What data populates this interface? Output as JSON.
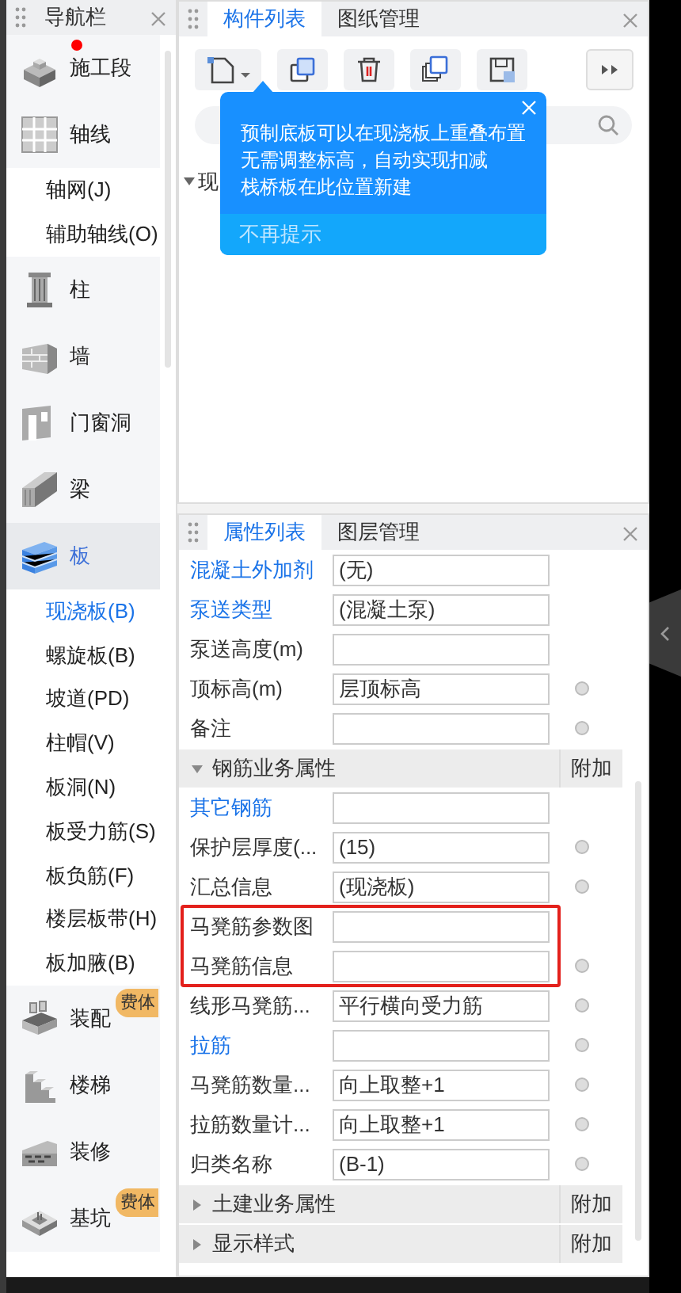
{
  "nav": {
    "title": "导航栏",
    "items": [
      {
        "label": "施工段",
        "selected": false,
        "notice": true
      },
      {
        "label": "轴线",
        "selected": false,
        "children": [
          {
            "label": "轴网(J)",
            "selected": false
          },
          {
            "label": "辅助轴线(O)",
            "selected": false
          }
        ]
      },
      {
        "label": "柱",
        "selected": false
      },
      {
        "label": "墙",
        "selected": false
      },
      {
        "label": "门窗洞",
        "selected": false
      },
      {
        "label": "梁",
        "selected": false
      },
      {
        "label": "板",
        "selected": true,
        "children": [
          {
            "label": "现浇板(B)",
            "selected": true
          },
          {
            "label": "螺旋板(B)",
            "selected": false
          },
          {
            "label": "坡道(PD)",
            "selected": false
          },
          {
            "label": "柱帽(V)",
            "selected": false
          },
          {
            "label": "板洞(N)",
            "selected": false
          },
          {
            "label": "板受力筋(S)",
            "selected": false
          },
          {
            "label": "板负筋(F)",
            "selected": false
          },
          {
            "label": "楼层板带(H)",
            "selected": false
          },
          {
            "label": "板加腋(B)",
            "selected": false
          }
        ]
      },
      {
        "label": "装配",
        "selected": false,
        "badge": "费体"
      },
      {
        "label": "楼梯",
        "selected": false
      },
      {
        "label": "装修",
        "selected": false
      },
      {
        "label": "基坑",
        "selected": false,
        "badge": "费体"
      }
    ]
  },
  "component_panel": {
    "tabs": [
      {
        "label": "构件列表",
        "selected": true
      },
      {
        "label": "图纸管理",
        "selected": false
      }
    ],
    "tree": [
      {
        "label": "现",
        "expanded": true
      }
    ],
    "tooltip": {
      "lines": [
        "预制底板可以在现浇板上重叠布置",
        "无需调整标高，自动实现扣减",
        "栈桥板在此位置新建"
      ],
      "dismiss": "不再提示"
    }
  },
  "property_panel": {
    "tabs": [
      {
        "label": "属性列表",
        "selected": true
      },
      {
        "label": "图层管理",
        "selected": false
      }
    ],
    "rows": [
      {
        "kind": "field",
        "name": "混凝土外加剂",
        "value": "(无)",
        "linked": true,
        "dot": false
      },
      {
        "kind": "field",
        "name": "泵送类型",
        "value": "(混凝土泵)",
        "linked": true,
        "dot": false
      },
      {
        "kind": "field",
        "name": "泵送高度(m)",
        "value": "",
        "linked": false,
        "dot": false
      },
      {
        "kind": "field",
        "name": "顶标高(m)",
        "value": "层顶标高",
        "linked": false,
        "dot": true
      },
      {
        "kind": "field",
        "name": "备注",
        "value": "",
        "linked": false,
        "dot": true
      },
      {
        "kind": "group",
        "name": "钢筋业务属性",
        "extra": "附加",
        "expanded": true
      },
      {
        "kind": "field",
        "name": "其它钢筋",
        "value": "",
        "linked": true,
        "dot": false
      },
      {
        "kind": "field",
        "name": "保护层厚度(...",
        "value": "(15)",
        "linked": false,
        "dot": true
      },
      {
        "kind": "field",
        "name": "汇总信息",
        "value": "(现浇板)",
        "linked": false,
        "dot": true
      },
      {
        "kind": "field",
        "name": "马凳筋参数图",
        "value": "",
        "linked": false,
        "dot": false,
        "highlighted": true
      },
      {
        "kind": "field",
        "name": "马凳筋信息",
        "value": "",
        "linked": false,
        "dot": true,
        "highlighted": true
      },
      {
        "kind": "field",
        "name": "线形马凳筋...",
        "value": "平行横向受力筋",
        "linked": false,
        "dot": true
      },
      {
        "kind": "field",
        "name": "拉筋",
        "value": "",
        "linked": true,
        "dot": true
      },
      {
        "kind": "field",
        "name": "马凳筋数量...",
        "value": "向上取整+1",
        "linked": false,
        "dot": true
      },
      {
        "kind": "field",
        "name": "拉筋数量计...",
        "value": "向上取整+1",
        "linked": false,
        "dot": true
      },
      {
        "kind": "field",
        "name": "归类名称",
        "value": "(B-1)",
        "linked": false,
        "dot": true
      },
      {
        "kind": "group",
        "name": "土建业务属性",
        "extra": "附加",
        "expanded": false
      },
      {
        "kind": "group",
        "name": "显示样式",
        "extra": "附加",
        "expanded": false
      }
    ]
  }
}
